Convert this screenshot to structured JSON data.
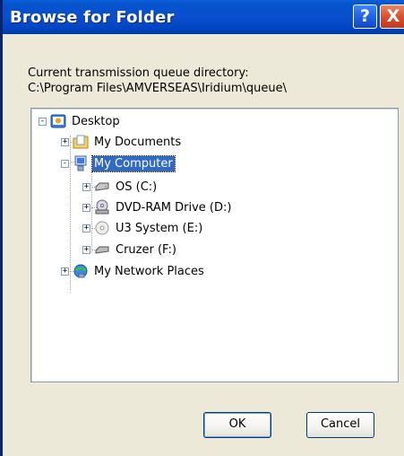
{
  "window": {
    "title": "Browse for Folder",
    "help_label": "?",
    "close_label": "X"
  },
  "prompt": {
    "line1": "Current transmission queue directory:",
    "line2": "C:\\Program Files\\AMVERSEAS\\Iridium\\queue\\"
  },
  "tree": {
    "items": [
      {
        "label": "Desktop",
        "icon": "desktop-icon",
        "expander": "-"
      },
      {
        "label": "My Documents",
        "icon": "my-documents-icon",
        "expander": "+"
      },
      {
        "label": "My Computer",
        "icon": "my-computer-icon",
        "expander": "-",
        "selected": true
      },
      {
        "label": "OS (C:)",
        "icon": "hard-drive-icon",
        "expander": "+"
      },
      {
        "label": "DVD-RAM Drive (D:)",
        "icon": "dvd-drive-icon",
        "expander": "+"
      },
      {
        "label": "U3 System (E:)",
        "icon": "cd-drive-icon",
        "expander": "+"
      },
      {
        "label": "Cruzer (F:)",
        "icon": "removable-drive-icon",
        "expander": "+"
      },
      {
        "label": "My Network Places",
        "icon": "network-places-icon",
        "expander": "+"
      }
    ]
  },
  "buttons": {
    "ok": "OK",
    "cancel": "Cancel"
  },
  "colors": {
    "titlebar": "#0a4fd0",
    "selection": "#316ac5",
    "dialog_bg": "#ece9d8"
  }
}
